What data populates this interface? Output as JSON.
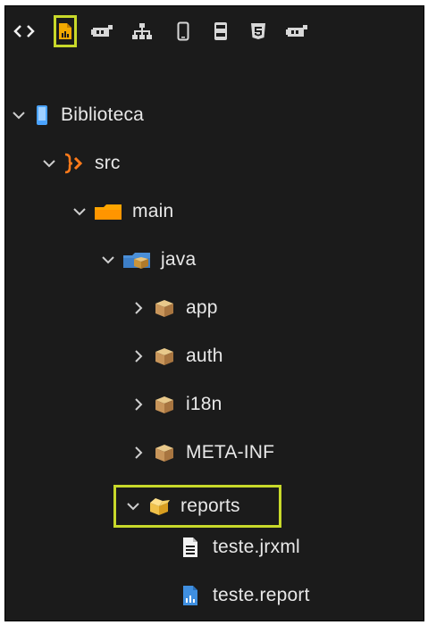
{
  "toolbar": {
    "buttons": [
      {
        "icon": "code-brackets-icon",
        "active": false
      },
      {
        "icon": "report-file-icon",
        "active": true
      },
      {
        "icon": "component-icon",
        "active": false
      },
      {
        "icon": "hierarchy-icon",
        "active": false
      },
      {
        "icon": "mobile-device-icon",
        "active": false
      },
      {
        "icon": "server-icon",
        "active": false
      },
      {
        "icon": "html5-icon",
        "active": false
      },
      {
        "icon": "component-alt-icon",
        "active": false
      }
    ],
    "highlight_color": "#c8d92a"
  },
  "tree": {
    "project": {
      "label": "Biblioteca",
      "expanded": true
    },
    "src": {
      "label": "src",
      "expanded": true
    },
    "main": {
      "label": "main",
      "expanded": true
    },
    "java": {
      "label": "java",
      "expanded": true
    },
    "packages": [
      {
        "label": "app",
        "expanded": false
      },
      {
        "label": "auth",
        "expanded": false
      },
      {
        "label": "i18n",
        "expanded": false
      },
      {
        "label": "META-INF",
        "expanded": false
      }
    ],
    "reports": {
      "label": "reports",
      "expanded": true,
      "files": [
        {
          "label": "teste.jrxml",
          "icon": "document-icon"
        },
        {
          "label": "teste.report",
          "icon": "report-file-icon"
        }
      ]
    }
  }
}
